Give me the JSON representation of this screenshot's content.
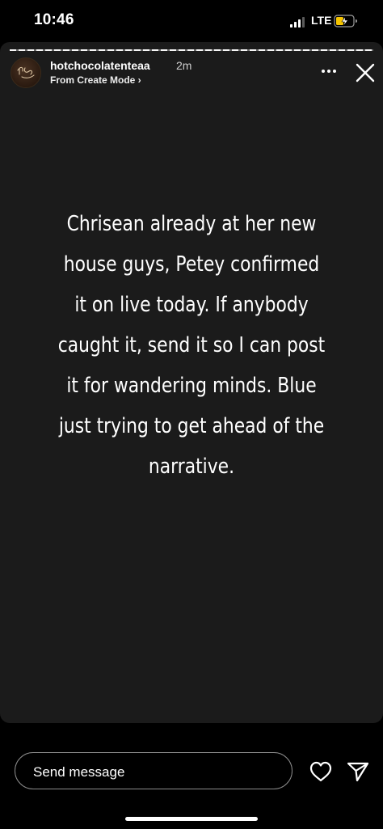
{
  "status_bar": {
    "time": "10:46",
    "network": "LTE",
    "battery_level": 0.45,
    "battery_charging": true,
    "signal_bars": 3
  },
  "story": {
    "progress": 1.0,
    "username": "hotchocolatenteaa",
    "timestamp": "2m",
    "source": "From Create Mode ›",
    "text": "Chrisean already at her new house guys, Petey confirmed it on live today. If anybody caught it, send it so I can post it for wandering minds. Blue just trying to get ahead of the narrative.",
    "background_color": "#1b1b1b"
  },
  "actions": {
    "more_icon": "more-horizontal-icon",
    "close_icon": "close-icon"
  },
  "composer": {
    "placeholder": "Send message",
    "like_icon": "heart-icon",
    "share_icon": "send-icon"
  }
}
